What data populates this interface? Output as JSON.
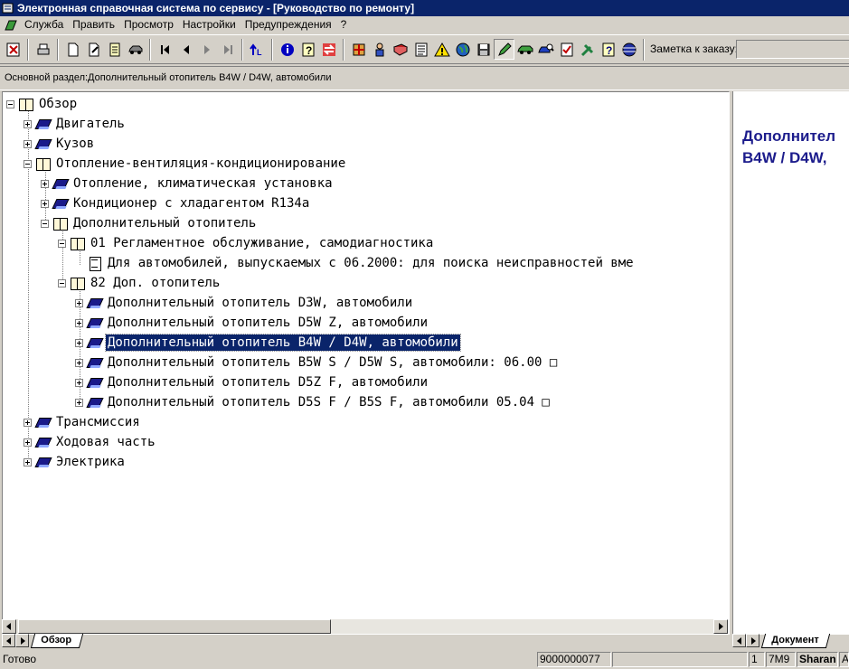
{
  "window": {
    "title": "Электронная справочная система по сервису - [Руководство по ремонту]"
  },
  "menu": [
    "Служба",
    "Править",
    "Просмотр",
    "Настройки",
    "Предупреждения",
    "?"
  ],
  "toolbar": {
    "buttons": [
      "exit-icon",
      "print-icon",
      "new-document-icon",
      "edit-document-icon",
      "notes-icon",
      "car-icon",
      "first-page-icon",
      "previous-icon",
      "next-icon",
      "last-page-icon",
      "back-link-icon",
      "info-icon",
      "help-icon",
      "swap-icon",
      "components-icon",
      "mechanic-icon",
      "book-red-icon",
      "list-icon",
      "warning-icon",
      "globe-icon",
      "disk-icon",
      "pencil-icon",
      "car-green-icon",
      "car-search-icon",
      "checklist-icon",
      "tools-icon",
      "help-page-icon",
      "sphere-icon"
    ],
    "note_label": "Заметка к заказу:",
    "note_value": ""
  },
  "section": {
    "text": "Основной раздел:Дополнительный отопитель B4W / D4W, автомобили"
  },
  "tree": {
    "root": "Обзор",
    "items": [
      {
        "label": "Двигатель"
      },
      {
        "label": "Кузов"
      },
      {
        "label": "Отопление-вентиляция-кондиционирование"
      },
      {
        "label": "Отопление, климатическая установка"
      },
      {
        "label": "Кондиционер с хладагентом R134a"
      },
      {
        "label": "Дополнительный отопитель"
      },
      {
        "label": "01 Регламентное обслуживание, самодиагностика"
      },
      {
        "label": "Для автомобилей, выпускаемых с 06.2000: для поиска неисправностей вме"
      },
      {
        "label": "82 Доп. отопитель"
      },
      {
        "label": "Дополнительный отопитель D3W, автомобили"
      },
      {
        "label": "Дополнительный отопитель D5W Z, автомобили"
      },
      {
        "label": "Дополнительный отопитель B4W / D4W, автомобили"
      },
      {
        "label": "Дополнительный отопитель B5W S / D5W S, автомобили: 06.00 □"
      },
      {
        "label": "Дополнительный отопитель D5Z F, автомобили"
      },
      {
        "label": "Дополнительный отопитель D5S F / B5S F, автомобили 05.04 □"
      },
      {
        "label": "Трансмиссия"
      },
      {
        "label": "Ходовая часть"
      },
      {
        "label": "Электрика"
      }
    ]
  },
  "tabs": {
    "left": "Обзор",
    "right": "Документ"
  },
  "document": {
    "title_line1": "Дополнител",
    "title_line2": "B4W / D4W,"
  },
  "status": {
    "text": "Готово",
    "number": "9000000077",
    "page": "1",
    "code": "7M9",
    "model": "Sharan",
    "extra": "A"
  },
  "colors": {
    "titlebar": "#0a246a",
    "selection": "#0a246a",
    "doc_title": "#1c1c8c",
    "face": "#d4d0c8"
  }
}
